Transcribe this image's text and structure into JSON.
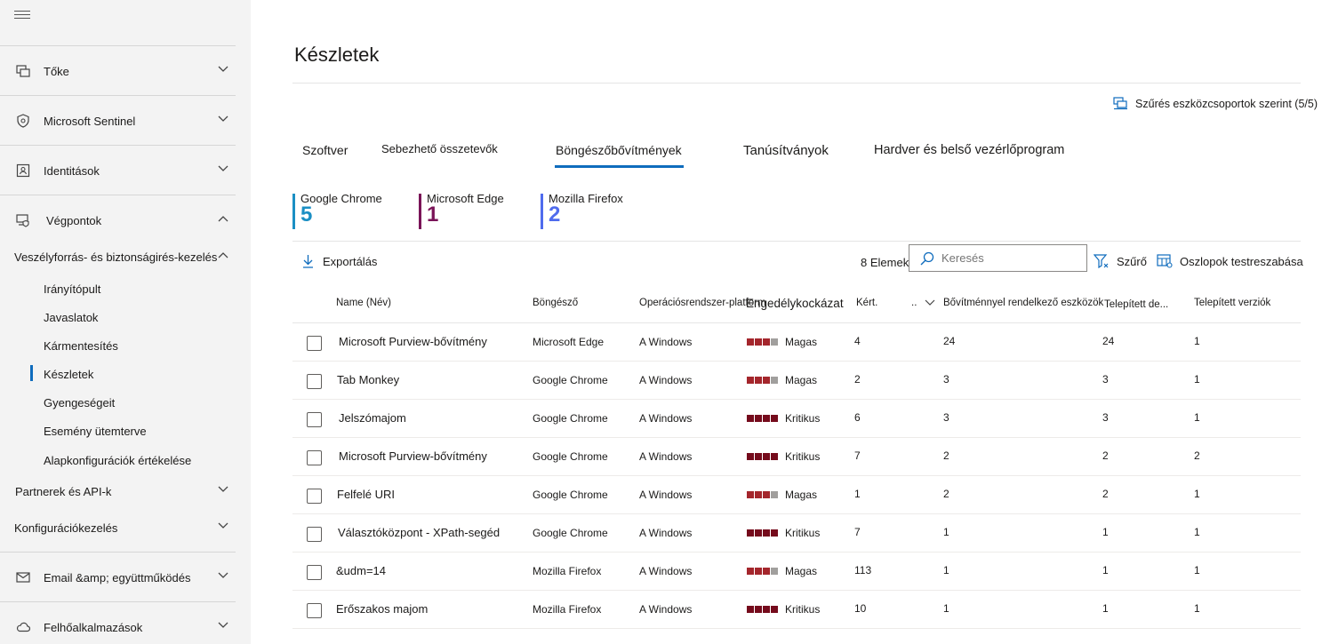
{
  "sidebar": {
    "items": [
      {
        "label": "Tőke",
        "icon": "assets-icon"
      },
      {
        "label": "Microsoft Sentinel",
        "icon": "shield-icon"
      },
      {
        "label": "Identitások",
        "icon": "identity-icon"
      },
      {
        "label": "Végpontok",
        "icon": "endpoints-icon"
      }
    ],
    "vuln_section": "Veszélyforrás- és biztonságirés-kezelés",
    "sub_items": [
      "Irányítópult",
      "Javaslatok",
      "Kármentesítés",
      "Készletek",
      "Gyengeségeit",
      "Esemény ütemterve",
      "Alapkonfigurációk értékelése"
    ],
    "partners": "Partnerek és API-k",
    "config": "Konfigurációkezelés",
    "email": "Email &amp; együttműködés",
    "cloud": "Felhőalkalmazások"
  },
  "page": {
    "title": "Készletek",
    "filter_groups": "Szűrés eszközcsoportok szerint (5/5)"
  },
  "tabs": [
    "Szoftver",
    "Sebezhető összetevők",
    "Böngészőbővítmények",
    "Tanúsítványok",
    "Hardver és belső vezérlőprogram"
  ],
  "stats": [
    {
      "name": "Google Chrome",
      "value": "5",
      "color": "#1b8fc4"
    },
    {
      "name": "Microsoft Edge",
      "value": "1",
      "color": "#7a1458"
    },
    {
      "name": "Mozilla Firefox",
      "value": "2",
      "color": "#4f6bed"
    }
  ],
  "toolbar": {
    "export": "Exportálás",
    "items_count": "8 Elemek",
    "search_placeholder": "Keresés",
    "filter": "Szűrő",
    "columns": "Oszlopok testreszabása"
  },
  "table": {
    "headers": [
      "Name (Név)",
      "Böngésző",
      "Operációsrendszer-platform",
      "Engedélykockázat",
      "Kért.",
      "..",
      "Bővítménnyel rendelkező eszközök",
      "Telepített de...",
      "Telepített verziók"
    ],
    "rows": [
      {
        "name": "Microsoft Purview-bővítmény",
        "browser": "Microsoft Edge",
        "os": "A Windows",
        "risk": "Magas",
        "requested": "4",
        "devices": "24",
        "installed_dev": "24",
        "versions": "1"
      },
      {
        "name": "Tab Monkey",
        "browser": "Google Chrome",
        "os": "A Windows",
        "risk": "Magas",
        "requested": "2",
        "devices": "3",
        "installed_dev": "3",
        "versions": "1"
      },
      {
        "name": "Jelszómajom",
        "browser": "Google Chrome",
        "os": "A Windows",
        "risk": "Kritikus",
        "requested": "6",
        "devices": "3",
        "installed_dev": "3",
        "versions": "1"
      },
      {
        "name": "Microsoft Purview-bővítmény",
        "browser": "Google Chrome",
        "os": "A Windows",
        "risk": "Kritikus",
        "requested": "7",
        "devices": "2",
        "installed_dev": "2",
        "versions": "2"
      },
      {
        "name": "Felfelé URI",
        "browser": "Google Chrome",
        "os": "A Windows",
        "risk": "Magas",
        "requested": "1",
        "devices": "2",
        "installed_dev": "2",
        "versions": "1"
      },
      {
        "name": "Választóközpont - XPath-segéd",
        "browser": "Google Chrome",
        "os": "A Windows",
        "risk": "Kritikus",
        "requested": "7",
        "devices": "1",
        "installed_dev": "1",
        "versions": "1"
      },
      {
        "name": "&udm=14",
        "browser": "Mozilla Firefox",
        "os": "A Windows",
        "risk": "Magas",
        "requested": "113",
        "devices": "1",
        "installed_dev": "1",
        "versions": "1"
      },
      {
        "name": "Erőszakos majom",
        "browser": "Mozilla Firefox",
        "os": "A Windows",
        "risk": "Kritikus",
        "requested": "10",
        "devices": "1",
        "installed_dev": "1",
        "versions": "1"
      }
    ]
  },
  "colors": {
    "accent": "#0f6cbd",
    "risk_high": "#a4262c",
    "risk_critical": "#750b1c",
    "risk_empty": "#a19f9d"
  }
}
